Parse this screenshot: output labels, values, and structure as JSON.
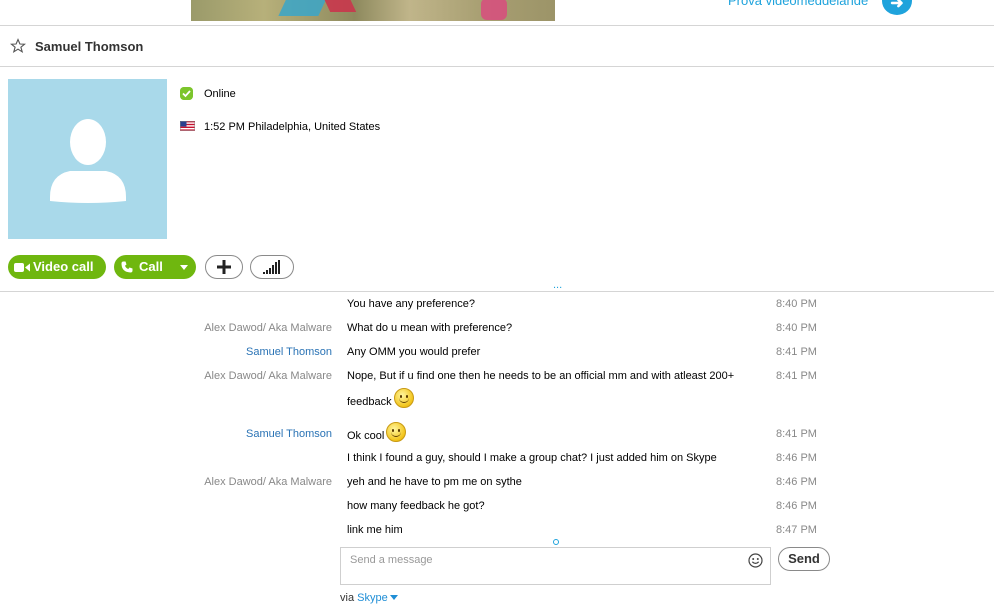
{
  "banner": {
    "link_text": "Prova videomeddelande",
    "arrow_icon": "arrow-right-icon"
  },
  "contact": {
    "name": "Samuel Thomson",
    "status": "Online",
    "local_time": "1:52 PM Philadelphia, United States"
  },
  "actions": {
    "video_call": "Video call",
    "call": "Call"
  },
  "more_indicator": "...",
  "messages": [
    {
      "sender": "",
      "text": "You have any preference?",
      "time": "8:40 PM",
      "emoji": false
    },
    {
      "sender": "Alex Dawod/ Aka Malware",
      "text": "What do u mean with preference?",
      "time": "8:40 PM",
      "emoji": false
    },
    {
      "sender": "Samuel Thomson",
      "text": "Any OMM you would prefer",
      "time": "8:41 PM",
      "emoji": false
    },
    {
      "sender": "Alex Dawod/ Aka Malware",
      "text": "Nope, But if u find one then he needs to be an official mm and with atleast 200+",
      "text2": "feedback",
      "time": "8:41 PM",
      "emoji": true
    },
    {
      "sender": "Samuel Thomson",
      "text": "Ok cool",
      "time": "8:41 PM",
      "emoji": true
    },
    {
      "sender": "",
      "text": "I think I found a guy, should I make a group chat? I just added him on Skype",
      "time": "8:46 PM",
      "emoji": false
    },
    {
      "sender": "Alex Dawod/ Aka Malware",
      "text": "yeh and he have to pm me on sythe",
      "time": "8:46 PM",
      "emoji": false
    },
    {
      "sender": "",
      "text": "how many feedback he got?",
      "time": "8:46 PM",
      "emoji": false
    },
    {
      "sender": "",
      "text": "link me him",
      "time": "8:47 PM",
      "emoji": false
    }
  ],
  "composer": {
    "placeholder": "Send a message",
    "send_label": "Send",
    "via_prefix": "via",
    "via_service": "Skype"
  },
  "colors": {
    "accent_green": "#6fb70f",
    "accent_blue": "#1fa3dc",
    "link_blue": "#2a73b5"
  }
}
